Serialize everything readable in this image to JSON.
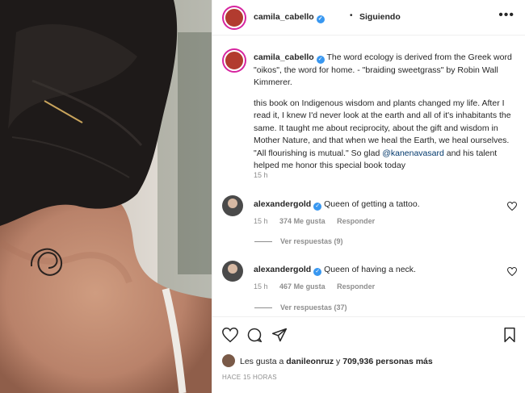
{
  "post": {
    "username": "camila_cabello",
    "follow_label": "Siguiendo",
    "caption_user": "camila_cabello",
    "caption_p1": " The word ecology is derived from the Greek word \"oikos\", the word for home. - \"braiding sweetgrass\" by Robin Wall Kimmerer.",
    "caption_p2_before": "this book on Indigenous wisdom and plants changed my life. After I read it, I knew I'd never look at the earth and all of it's inhabitants the same. It taught me about reciprocity, about the gift and wisdom in Mother Nature, and that when we heal the Earth, we heal ourselves. \"All flourishing is mutual.\" So glad ",
    "caption_mention": "@kanenavasard",
    "caption_p2_after": " and his talent helped me honor this special book today",
    "caption_time": "15 h"
  },
  "comments": [
    {
      "username": "alexandergold",
      "text": "Queen of getting a tattoo.",
      "time": "15 h",
      "likes": "374 Me gusta",
      "reply_label": "Responder",
      "view_replies": "Ver respuestas (9)"
    },
    {
      "username": "alexandergold",
      "text": "Queen of having a neck.",
      "time": "15 h",
      "likes": "467 Me gusta",
      "reply_label": "Responder",
      "view_replies": "Ver respuestas (37)"
    }
  ],
  "likes_line": {
    "prefix": "Les gusta a ",
    "user": "danileonruz",
    "middle": " y ",
    "count": "709,936 personas más"
  },
  "posted_ago": "HACE 15 HORAS",
  "icons": [
    "verified-badge-icon",
    "more-options-icon",
    "heart-icon",
    "comment-icon",
    "share-icon",
    "bookmark-icon"
  ]
}
